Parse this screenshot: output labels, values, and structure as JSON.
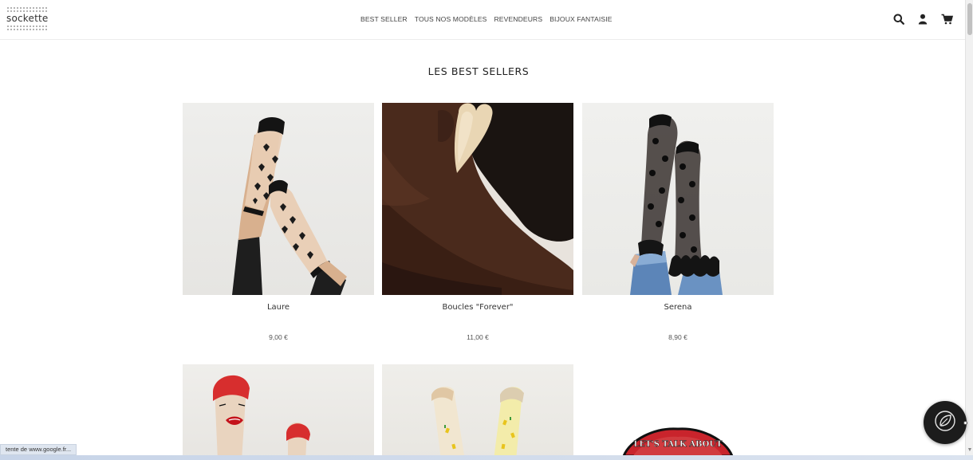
{
  "header": {
    "logo_text": "sockette",
    "nav": [
      "BEST SELLER",
      "TOUS NOS MODÈLES",
      "REVENDEURS",
      "BIJOUX FANTAISIE"
    ],
    "icons": [
      "search-icon",
      "user-icon",
      "cart-icon"
    ]
  },
  "section": {
    "title": "LES BEST SELLERS"
  },
  "products": [
    {
      "name": "Laure",
      "price": "9,00 €"
    },
    {
      "name": "Boucles \"Forever\"",
      "price": "11,00 €"
    },
    {
      "name": "Serena",
      "price": "8,90 €"
    }
  ],
  "patch_text": "LET'S TALK ABOUT",
  "status": {
    "text": "tente de www.google.fr..."
  },
  "widget": {
    "icon": "leaf-icon"
  },
  "colors": {
    "widget_bg": "#1c1c1c",
    "patch_red": "#c9242c"
  }
}
